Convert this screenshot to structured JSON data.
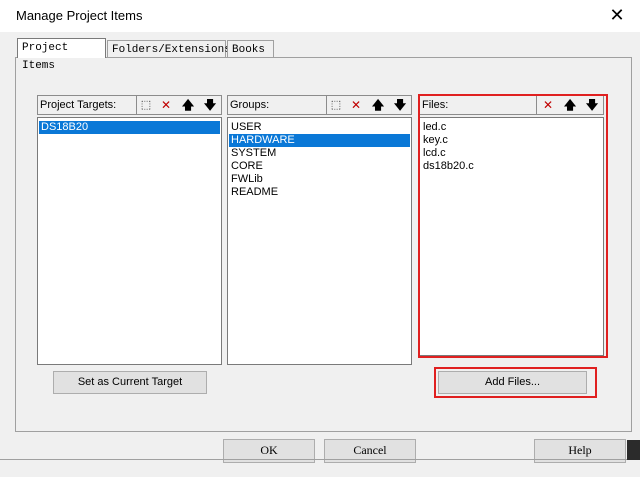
{
  "window": {
    "title": "Manage Project Items",
    "close_glyph": "✕"
  },
  "tabs": [
    {
      "label": "Project Items",
      "active": true
    },
    {
      "label": "Folders/Extensions",
      "active": false
    },
    {
      "label": "Books",
      "active": false
    }
  ],
  "targets": {
    "label": "Project Targets:",
    "items": [
      "DS18B20"
    ],
    "selected": "DS18B20"
  },
  "groups": {
    "label": "Groups:",
    "items": [
      "USER",
      "HARDWARE",
      "SYSTEM",
      "CORE",
      "FWLib",
      "README"
    ],
    "selected": "HARDWARE"
  },
  "files": {
    "label": "Files:",
    "items": [
      "led.c",
      "key.c",
      "lcd.c",
      "ds18b20.c"
    ]
  },
  "toolbar_glyphs": {
    "new": "⬚",
    "delete": "✕",
    "up": "🡅",
    "down": "🡇"
  },
  "buttons": {
    "set_current_target": "Set as Current Target",
    "add_files": "Add Files...",
    "ok": "OK",
    "cancel": "Cancel",
    "help": "Help"
  },
  "colors": {
    "highlight": "#e02020",
    "selection": "#0a78d7"
  }
}
